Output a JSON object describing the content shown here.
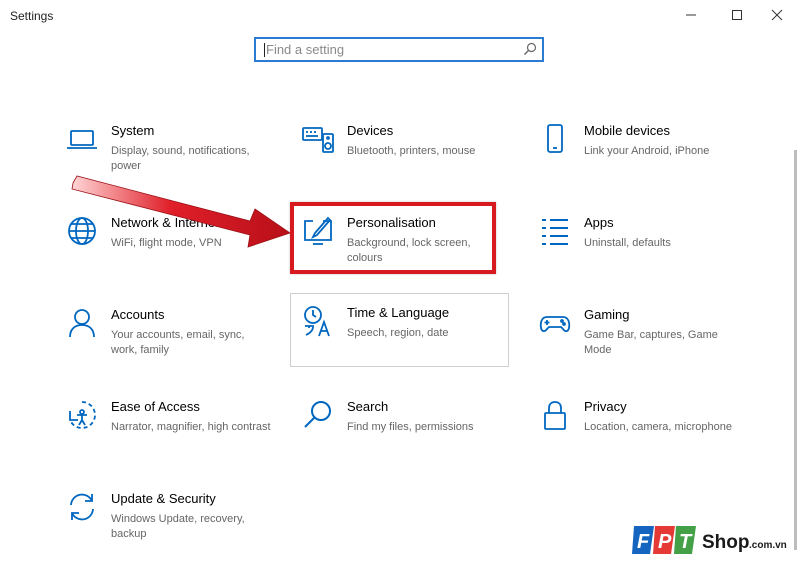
{
  "window": {
    "title": "Settings"
  },
  "search": {
    "placeholder": "Find a setting"
  },
  "tiles": [
    {
      "name": "System",
      "desc": "Display, sound, notifications, power",
      "icon": "laptop-icon"
    },
    {
      "name": "Devices",
      "desc": "Bluetooth, printers, mouse",
      "icon": "keyboard-speaker-icon"
    },
    {
      "name": "Mobile devices",
      "desc": "Link your Android, iPhone",
      "icon": "phone-icon"
    },
    {
      "name": "Network & Internet",
      "desc": "WiFi, flight mode, VPN",
      "icon": "globe-icon"
    },
    {
      "name": "Personalisation",
      "desc": "Background, lock screen, colours",
      "icon": "pen-monitor-icon"
    },
    {
      "name": "Apps",
      "desc": "Uninstall, defaults",
      "icon": "list-icon"
    },
    {
      "name": "Accounts",
      "desc": "Your accounts, email, sync, work, family",
      "icon": "person-icon"
    },
    {
      "name": "Time & Language",
      "desc": "Speech, region, date",
      "icon": "time-language-icon"
    },
    {
      "name": "Gaming",
      "desc": "Game Bar, captures, Game Mode",
      "icon": "gamepad-icon"
    },
    {
      "name": "Ease of Access",
      "desc": "Narrator, magnifier, high contrast",
      "icon": "ease-of-access-icon"
    },
    {
      "name": "Search",
      "desc": "Find my files, permissions",
      "icon": "search-icon"
    },
    {
      "name": "Privacy",
      "desc": "Location, camera, microphone",
      "icon": "lock-icon"
    },
    {
      "name": "Update & Security",
      "desc": "Windows Update, recovery, backup",
      "icon": "sync-icon"
    }
  ],
  "watermark": {
    "brand": "FPT Shop.com.vn"
  },
  "colors": {
    "accent": "#0067c0",
    "highlight": "#d71920",
    "search_border": "#2a7bd1"
  }
}
